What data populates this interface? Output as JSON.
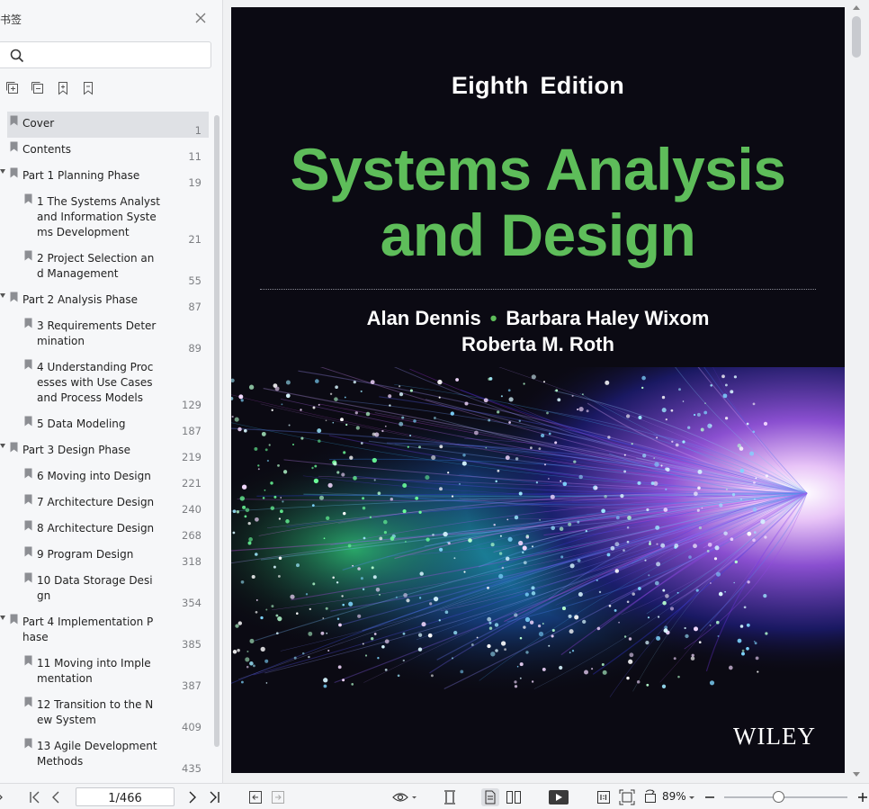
{
  "sidebar": {
    "title": "书签",
    "search": {
      "placeholder": "",
      "value": ""
    },
    "tools": [
      "expand-all-icon",
      "collapse-all-icon",
      "add-bookmark-icon",
      "bookmark-outline-icon"
    ],
    "bookmarks": [
      {
        "label": "Cover",
        "page": "1",
        "level": 0,
        "active": true
      },
      {
        "label": "Contents",
        "page": "11",
        "level": 0
      },
      {
        "label": "Part 1 Planning Phase",
        "page": "19",
        "level": 0,
        "expanded": true
      },
      {
        "label": "1 The Systems Analyst\nand Information Syste\nms  Development",
        "page": "21",
        "level": 1
      },
      {
        "label": "2 Project Selection an\nd Management",
        "page": "55",
        "level": 1
      },
      {
        "label": "Part 2 Analysis Phase",
        "page": "87",
        "level": 0,
        "expanded": true
      },
      {
        "label": "3 Requirements Deter\nmination",
        "page": "89",
        "level": 1
      },
      {
        "label": "4 Understanding Proc\nesses with Use  Cases\nand Process Models",
        "page": "129",
        "level": 1
      },
      {
        "label": "5 Data Modeling",
        "page": "187",
        "level": 1
      },
      {
        "label": "Part 3 Design Phase",
        "page": "219",
        "level": 0,
        "expanded": true
      },
      {
        "label": "6 Moving into Design",
        "page": "221",
        "level": 1
      },
      {
        "label": "7 Architecture Design",
        "page": "240",
        "level": 1
      },
      {
        "label": "8 Architecture Design",
        "page": "268",
        "level": 1
      },
      {
        "label": "9 Program Design",
        "page": "318",
        "level": 1
      },
      {
        "label": "10 Data Storage Desi\ngn",
        "page": "354",
        "level": 1
      },
      {
        "label": "Part 4 Implementation P\nhase",
        "page": "385",
        "level": 0,
        "expanded": true
      },
      {
        "label": "11 Moving into Imple\nmentation",
        "page": "387",
        "level": 1
      },
      {
        "label": "12 Transition to the N\new System",
        "page": "409",
        "level": 1
      },
      {
        "label": "13 Agile Development\nMethods",
        "page": "435",
        "level": 1
      }
    ]
  },
  "cover": {
    "edition": "Eighth  Edition",
    "title_line1": "Systems Analysis",
    "title_line2": "and Design",
    "author1": "Alan Dennis",
    "author_sep": "•",
    "author2": "Barbara Haley Wixom",
    "author3": "Roberta M. Roth",
    "publisher": "WILEY",
    "colors": {
      "background": "#0b0a13",
      "title": "#5ebd5a",
      "text": "#ffffff"
    }
  },
  "toolbar": {
    "page_indicator": "1/466",
    "zoom": "89%",
    "zoom_level": 0.44,
    "icons": [
      "first-page-icon",
      "prev-page-icon",
      "next-page-icon",
      "last-page-icon",
      "back-icon",
      "forward-icon",
      "eye-mode-icon",
      "fit-width-icon",
      "single-page-icon",
      "two-page-icon",
      "play-icon",
      "actual-size-icon",
      "fit-page-icon",
      "rotate-icon",
      "zoom-out-icon",
      "zoom-in-icon"
    ]
  }
}
